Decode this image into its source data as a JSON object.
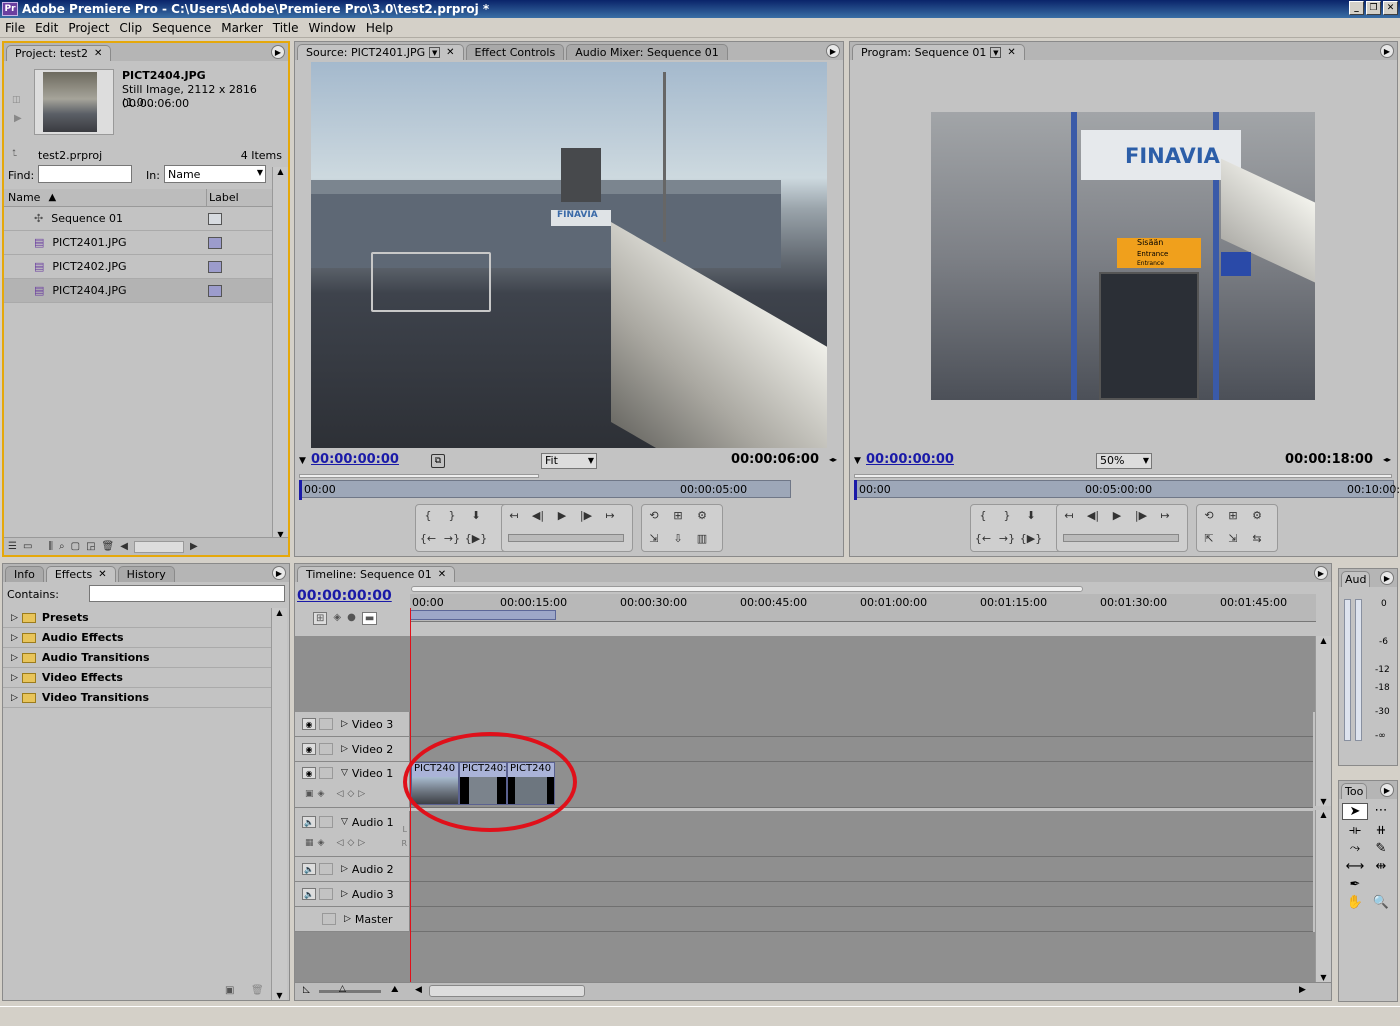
{
  "app": {
    "title": "Adobe Premiere Pro - C:\\Users\\Adobe\\Premiere Pro\\3.0\\test2.prproj *",
    "logo": "Pr"
  },
  "menu": [
    "File",
    "Edit",
    "Project",
    "Clip",
    "Sequence",
    "Marker",
    "Title",
    "Window",
    "Help"
  ],
  "project": {
    "tab": "Project: test2",
    "clip_name": "PICT2404.JPG",
    "clip_info": "Still Image, 2112 x 2816 (1.0...",
    "clip_duration": "00:00:06:00",
    "project_file": "test2.prproj",
    "item_count": "4 Items",
    "find_label": "Find:",
    "in_label": "In:",
    "in_value": "Name",
    "col_name": "Name",
    "col_label": "Label",
    "items": [
      {
        "name": "Sequence 01",
        "color": "#d7dbe0"
      },
      {
        "name": "PICT2401.JPG",
        "color": "#9c9ccc"
      },
      {
        "name": "PICT2402.JPG",
        "color": "#9c9ccc"
      },
      {
        "name": "PICT2404.JPG",
        "color": "#9c9ccc"
      }
    ]
  },
  "source": {
    "tabs": [
      "Source: PICT2401.JPG",
      "Effect Controls",
      "Audio Mixer: Sequence 01"
    ],
    "timecode": "00:00:00:00",
    "fit": "Fit",
    "duration": "00:00:06:00",
    "ruler_start": "00:00",
    "ruler_mid": "00:00:05:00",
    "sign": "FINAVIA"
  },
  "program": {
    "tab": "Program: Sequence 01",
    "timecode": "00:00:00:00",
    "zoom": "50%",
    "duration": "00:00:18:00",
    "ruler": [
      "00:00",
      "00:05:00:00",
      "00:10:00:"
    ],
    "sign": "FINAVIA",
    "sign2": "Sisään",
    "sign3": "Entrance",
    "sign4": "Entrance"
  },
  "effects": {
    "tabs": [
      "Info",
      "Effects",
      "History"
    ],
    "contains_label": "Contains:",
    "folders": [
      "Presets",
      "Audio Effects",
      "Audio Transitions",
      "Video Effects",
      "Video Transitions"
    ]
  },
  "timeline": {
    "tab": "Timeline: Sequence 01",
    "timecode": "00:00:00:00",
    "ruler": [
      "00:00",
      "00:00:15:00",
      "00:00:30:00",
      "00:00:45:00",
      "00:01:00:00",
      "00:01:15:00",
      "00:01:30:00",
      "00:01:45:00"
    ],
    "tracks": [
      "Video 3",
      "Video 2",
      "Video 1",
      "Audio 1",
      "Audio 2",
      "Audio 3",
      "Master"
    ],
    "clips": [
      "PICT240",
      "PICT240:",
      "PICT240"
    ],
    "lr": [
      "L",
      "R"
    ]
  },
  "audio_meter": {
    "tab": "Aud",
    "scale": [
      "0",
      "-6",
      "-12",
      "-18",
      "-30",
      "-∞"
    ]
  },
  "tools": {
    "tab": "Too"
  },
  "colors": {
    "accent": "#1a1aa8",
    "panel": "#c3c3c3",
    "highlight": "#e5a80b",
    "annotation": "#e0101a"
  }
}
